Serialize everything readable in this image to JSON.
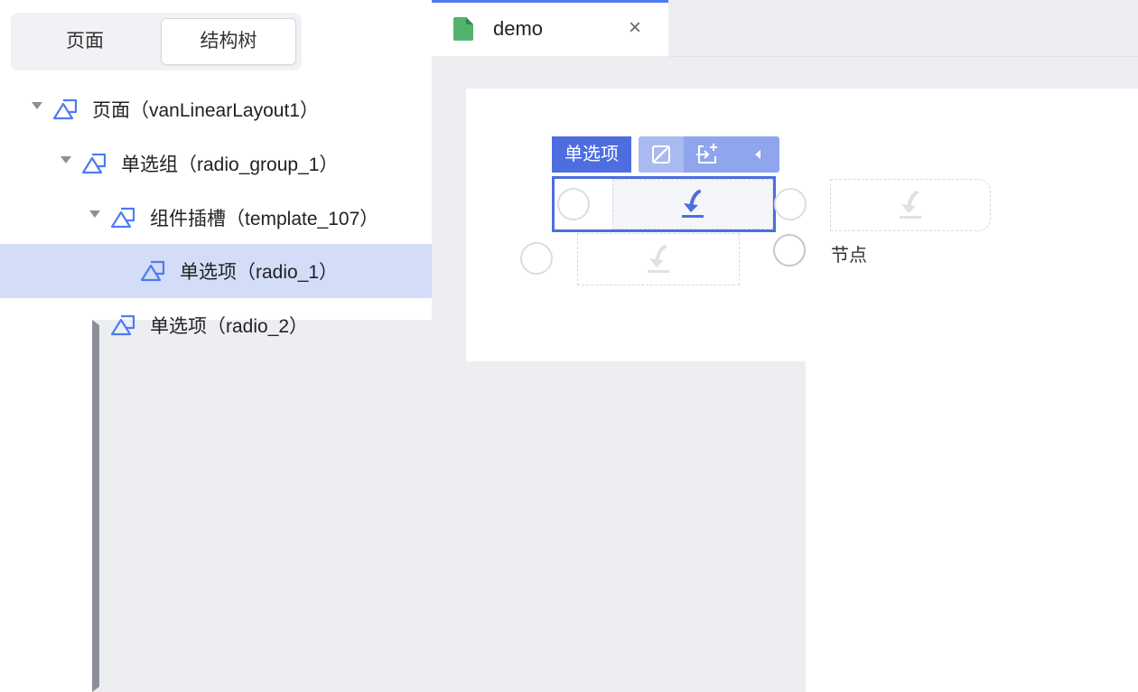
{
  "left_panel": {
    "segments": [
      "页面",
      "结构树"
    ],
    "active_segment": "结构树",
    "tree": [
      {
        "label": "页面（vanLinearLayout1）",
        "expanded": true,
        "level": 0
      },
      {
        "label": "单选组（radio_group_1）",
        "expanded": true,
        "level": 1
      },
      {
        "label": "组件插槽（template_107）",
        "expanded": true,
        "level": 2
      },
      {
        "label": "单选项（radio_1）",
        "selected": true,
        "level": 3
      },
      {
        "label": "单选项（radio_2）",
        "expanded": false,
        "level": 2
      }
    ]
  },
  "editor": {
    "tab": {
      "title": "demo",
      "close": "×",
      "icon": "file-icon"
    },
    "selection_tag": "单选项",
    "toolbar_icons": [
      "hide-icon",
      "insert-icon",
      "collapse-left-icon"
    ],
    "node_text": "节点"
  },
  "colors": {
    "accent": "#4d6de0",
    "tree_selected": "#d3ddf8",
    "tab_indicator": "#4d7cf2",
    "file_icon": "#52b36e",
    "canvas_bg": "#eceef2"
  }
}
